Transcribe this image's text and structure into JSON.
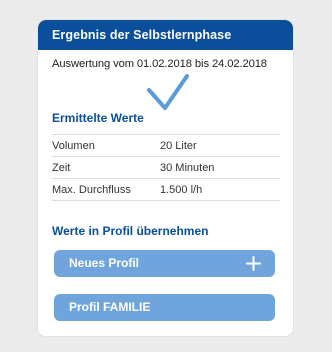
{
  "card": {
    "header_title": "Ergebnis der Selbstlernphase",
    "period_text": "Auswertung vom 01.02.2018 bis 24.02.2018",
    "check_icon": "check-icon"
  },
  "values": {
    "title": "Ermittelte Werte",
    "rows": [
      {
        "label": "Volumen",
        "value": "20 Liter"
      },
      {
        "label": "Zeit",
        "value": "30 Minuten"
      },
      {
        "label": "Max. Durchfluss",
        "value": "1.500 l/h"
      }
    ]
  },
  "profiles": {
    "title": "Werte in Profil übernehmen",
    "new_profile_label": "Neues Profil",
    "new_profile_icon": "plus-icon",
    "family_profile_label": "Profil FAMILIE"
  },
  "colors": {
    "header_bg": "#0a4e9c",
    "accent_text": "#0a4e9c",
    "button_bg": "#6fa5dc",
    "check": "#5b9bd9",
    "page_bg": "#ebebeb"
  }
}
